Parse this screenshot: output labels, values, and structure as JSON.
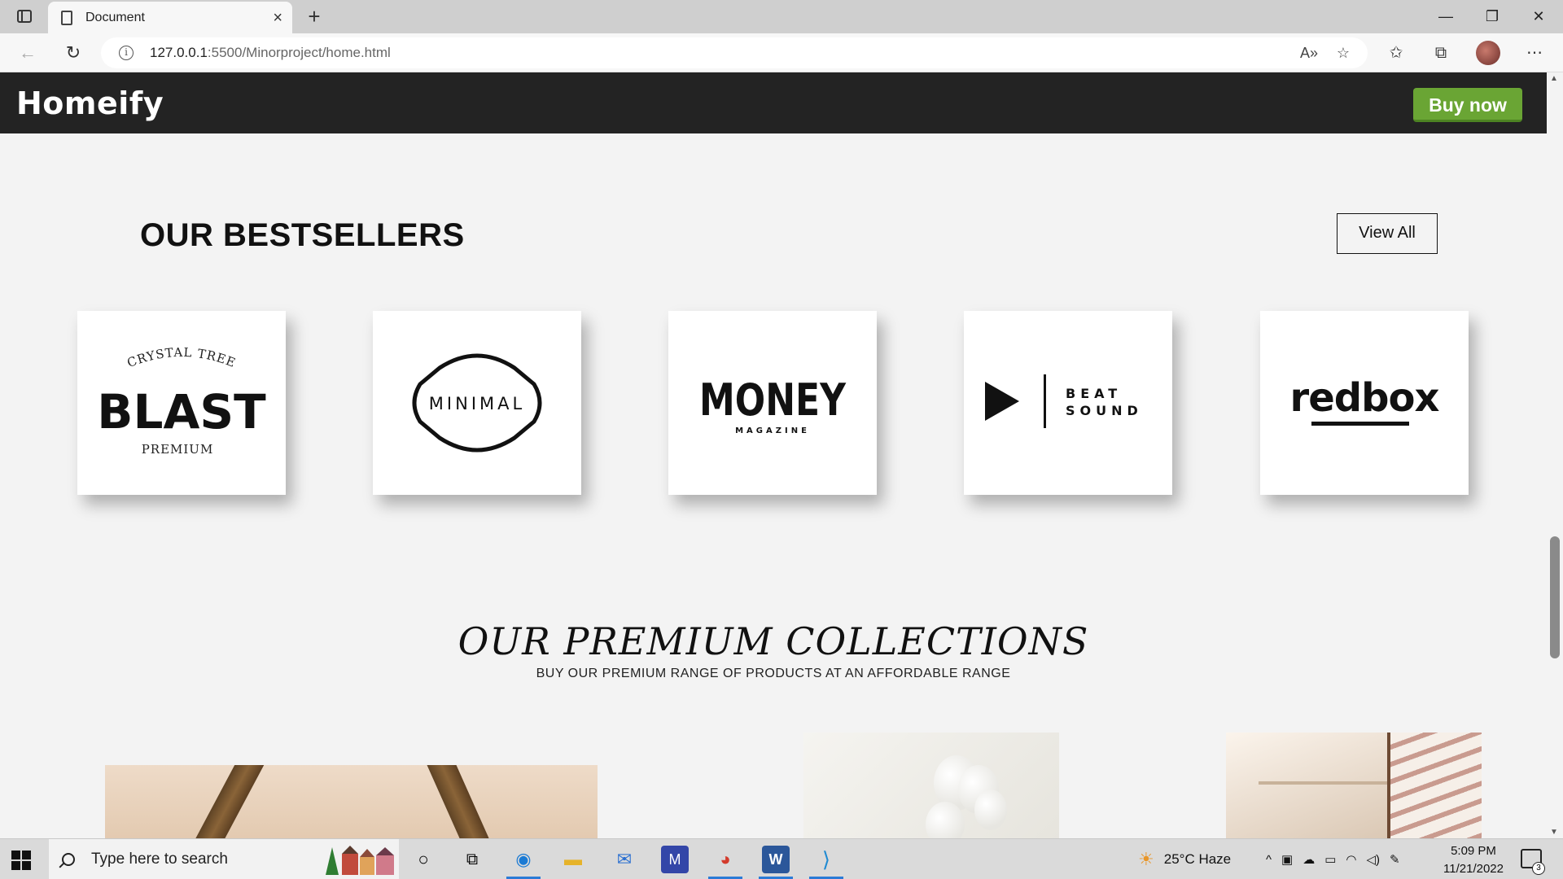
{
  "browser": {
    "tab_title": "Document",
    "url_host": "127.0.0.1",
    "url_path": ":5500/Minorproject/home.html",
    "new_tab": "+",
    "close": "×"
  },
  "site": {
    "logo": "Homeify",
    "buy_button": "Buy now",
    "accent": "#6aa534",
    "header_bg": "#232323"
  },
  "bestsellers": {
    "title": "OUR BESTSELLERS",
    "view_all": "View All",
    "brands": [
      {
        "top": "CRYSTAL TREE",
        "main": "BLAST",
        "bottom": "PREMIUM"
      },
      {
        "main": "MINIMAL"
      },
      {
        "main": "MONEY",
        "bottom": "MAGAZINE"
      },
      {
        "main": "BEAT",
        "bottom": "SOUND"
      },
      {
        "main": "redbox"
      }
    ]
  },
  "premium": {
    "title": "OUR PREMIUM COLLECTIONS",
    "subtitle": "BUY OUR PREMIUM RANGE OF PRODUCTS AT AN AFFORDABLE RANGE"
  },
  "taskbar": {
    "search_placeholder": "Type here to search",
    "weather": "25°C  Haze",
    "time": "5:09 PM",
    "date": "11/21/2022",
    "notifications": "3"
  }
}
